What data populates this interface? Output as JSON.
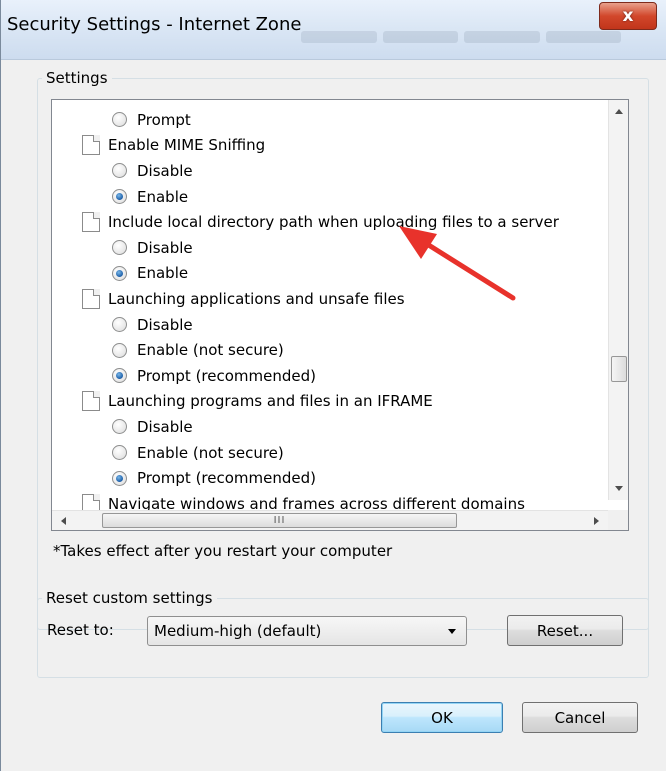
{
  "window": {
    "title": "Security Settings - Internet Zone",
    "close_label": "x"
  },
  "settings": {
    "group_label": "Settings",
    "rows": [
      {
        "kind": "option",
        "label": "Prompt",
        "checked": false
      },
      {
        "kind": "category",
        "label": "Enable MIME Sniffing"
      },
      {
        "kind": "option",
        "label": "Disable",
        "checked": false
      },
      {
        "kind": "option",
        "label": "Enable",
        "checked": true
      },
      {
        "kind": "category",
        "label": "Include local directory path when uploading files to a server"
      },
      {
        "kind": "option",
        "label": "Disable",
        "checked": false
      },
      {
        "kind": "option",
        "label": "Enable",
        "checked": true
      },
      {
        "kind": "category",
        "label": "Launching applications and unsafe files"
      },
      {
        "kind": "option",
        "label": "Disable",
        "checked": false
      },
      {
        "kind": "option",
        "label": "Enable (not secure)",
        "checked": false
      },
      {
        "kind": "option",
        "label": "Prompt (recommended)",
        "checked": true
      },
      {
        "kind": "category",
        "label": "Launching programs and files in an IFRAME"
      },
      {
        "kind": "option",
        "label": "Disable",
        "checked": false
      },
      {
        "kind": "option",
        "label": "Enable (not secure)",
        "checked": false
      },
      {
        "kind": "option",
        "label": "Prompt (recommended)",
        "checked": true
      },
      {
        "kind": "category",
        "label": "Navigate windows and frames across different domains"
      }
    ],
    "hscroll_grip": "III",
    "note": "*Takes effect after you restart your computer"
  },
  "reset": {
    "group_label": "Reset custom settings",
    "reset_to_label": "Reset to:",
    "selected_level": "Medium-high (default)",
    "reset_button": "Reset..."
  },
  "footer": {
    "ok_label": "OK",
    "cancel_label": "Cancel"
  },
  "annotation": {
    "arrow_color": "#e8322b"
  }
}
